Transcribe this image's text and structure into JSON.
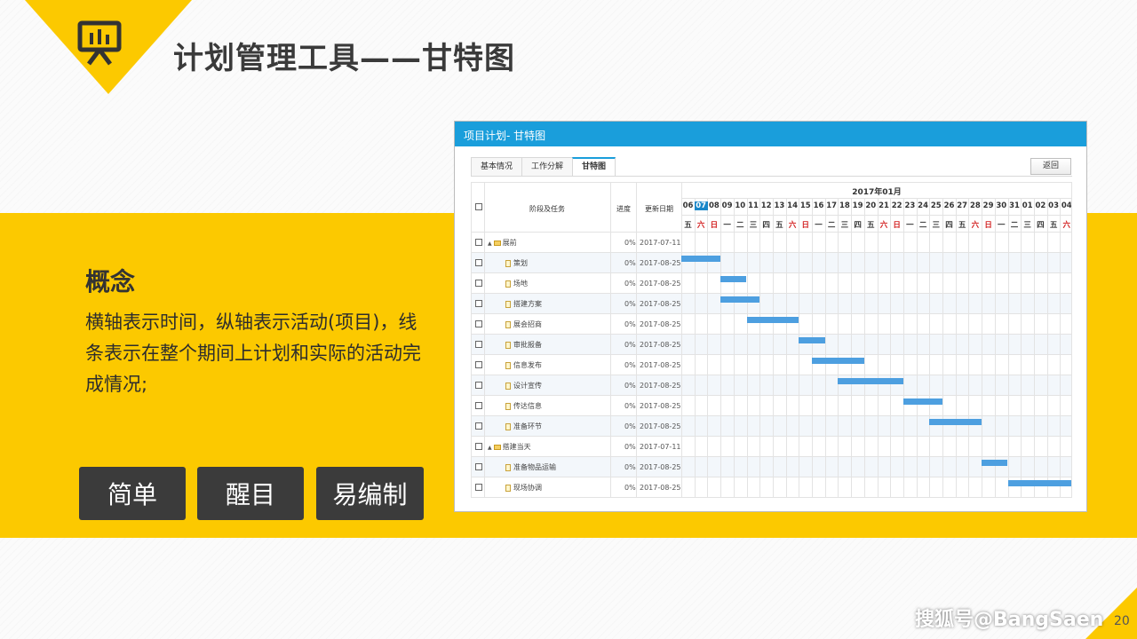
{
  "slide": {
    "title": "计划管理工具——甘特图",
    "concept_title": "概念",
    "concept_text": "横轴表示时间，纵轴表示活动(项目)，线条表示在整个期间上计划和实际的活动完成情况;",
    "tags": [
      "简单",
      "醒目",
      "易编制"
    ],
    "watermark": "搜狐号@BangSaen",
    "page_number": "20",
    "accent_color": "#fcc900",
    "icon": "presentation-chart-icon"
  },
  "app": {
    "window_title": "项目计划- 甘特图",
    "tabs": [
      "基本情况",
      "工作分解",
      "甘特图"
    ],
    "active_tab": "甘特图",
    "back_button": "返回",
    "header_color": "#1a9edb",
    "columns": {
      "task": "阶段及任务",
      "progress": "进度",
      "updated": "更新日期"
    },
    "month_label": "2017年01月",
    "days": [
      "06",
      "07",
      "08",
      "09",
      "10",
      "11",
      "12",
      "13",
      "14",
      "15",
      "16",
      "17",
      "18",
      "19",
      "20",
      "21",
      "22",
      "23",
      "24",
      "25",
      "26",
      "27",
      "28",
      "29",
      "30",
      "31",
      "01",
      "02",
      "03",
      "04"
    ],
    "weekdays": [
      "五",
      "六",
      "日",
      "一",
      "二",
      "三",
      "四",
      "五",
      "六",
      "日",
      "一",
      "二",
      "三",
      "四",
      "五",
      "六",
      "日",
      "一",
      "二",
      "三",
      "四",
      "五",
      "六",
      "日",
      "一",
      "二",
      "三",
      "四",
      "五",
      "六"
    ],
    "highlight_day": "07",
    "rows": [
      {
        "name": "展前",
        "type": "phase",
        "progress": "0%",
        "date": "2017-07-11",
        "bar": null
      },
      {
        "name": "策划",
        "type": "task",
        "progress": "0%",
        "date": "2017-08-25",
        "bar": [
          0,
          3
        ]
      },
      {
        "name": "场地",
        "type": "task",
        "progress": "0%",
        "date": "2017-08-25",
        "bar": [
          3,
          5
        ]
      },
      {
        "name": "搭建方案",
        "type": "task",
        "progress": "0%",
        "date": "2017-08-25",
        "bar": [
          3,
          6
        ]
      },
      {
        "name": "展会招商",
        "type": "task",
        "progress": "0%",
        "date": "2017-08-25",
        "bar": [
          5,
          9
        ]
      },
      {
        "name": "审批报备",
        "type": "task",
        "progress": "0%",
        "date": "2017-08-25",
        "bar": [
          9,
          11
        ]
      },
      {
        "name": "信息发布",
        "type": "task",
        "progress": "0%",
        "date": "2017-08-25",
        "bar": [
          10,
          14
        ]
      },
      {
        "name": "设计宣传",
        "type": "task",
        "progress": "0%",
        "date": "2017-08-25",
        "bar": [
          12,
          17
        ]
      },
      {
        "name": "传达信息",
        "type": "task",
        "progress": "0%",
        "date": "2017-08-25",
        "bar": [
          17,
          20
        ]
      },
      {
        "name": "准备环节",
        "type": "task",
        "progress": "0%",
        "date": "2017-08-25",
        "bar": [
          19,
          23
        ]
      },
      {
        "name": "搭建当天",
        "type": "phase",
        "progress": "0%",
        "date": "2017-07-11",
        "bar": null
      },
      {
        "name": "准备物品运输",
        "type": "task",
        "progress": "0%",
        "date": "2017-08-25",
        "bar": [
          23,
          25
        ]
      },
      {
        "name": "现场协调",
        "type": "task",
        "progress": "0%",
        "date": "2017-08-25",
        "bar": [
          25,
          30
        ]
      }
    ]
  }
}
